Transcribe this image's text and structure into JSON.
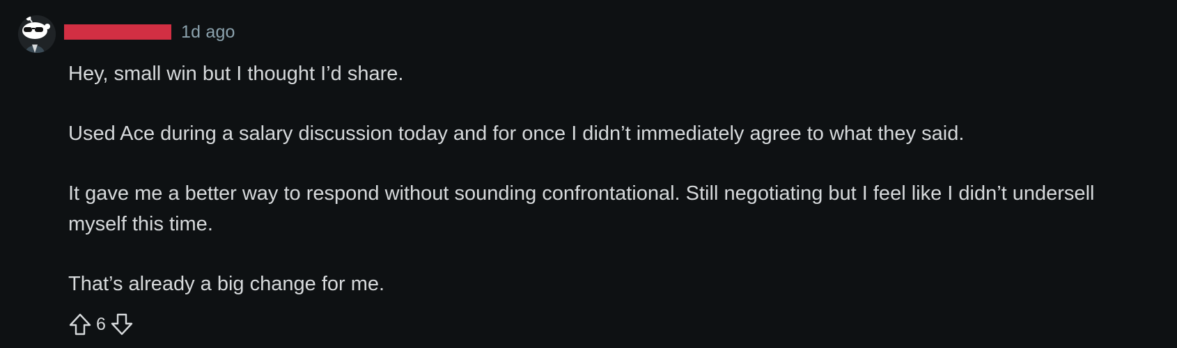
{
  "comment": {
    "timestamp": "1d ago",
    "paragraphs": [
      "Hey, small win but I thought I’d share.",
      "Used Ace during a salary discussion today and for once I didn’t immediately agree to what they said.",
      "It gave me a better way to respond without sounding confrontational. Still negotiating but I feel like I didn’t undersell myself this time.",
      "That’s already a big change for me."
    ],
    "votes": {
      "score": "6",
      "upvote_icon": "arrow-up-outline",
      "downvote_icon": "arrow-down-outline"
    }
  },
  "colors": {
    "background": "#0e1113",
    "text": "#d7dadc",
    "meta": "#8ba2ad",
    "redaction": "#d22f43"
  }
}
